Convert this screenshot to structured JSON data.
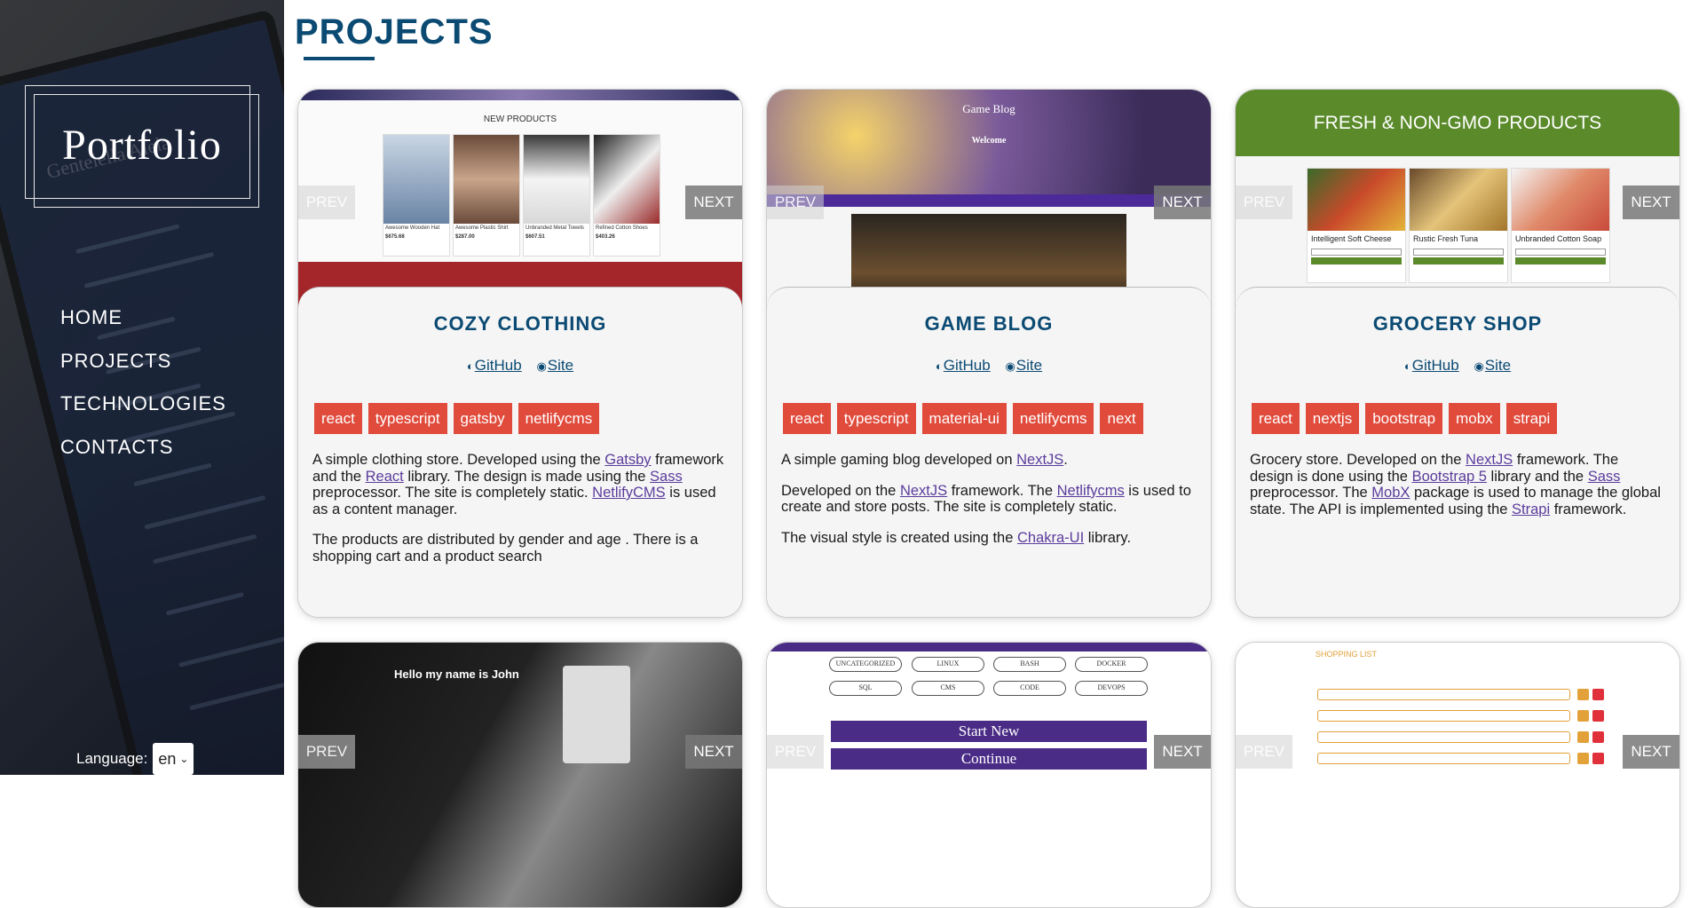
{
  "sidebar": {
    "logo": "Portfolio",
    "nav": [
      "HOME",
      "PROJECTS",
      "TECHNOLOGIES",
      "CONTACTS"
    ],
    "language_label": "Language:",
    "language_value": "en"
  },
  "main": {
    "title": "PROJECTS",
    "carousel": {
      "prev": "PREV",
      "next": "NEXT"
    },
    "links": {
      "github": "GitHub",
      "site": "Site"
    },
    "projects": [
      {
        "title": "COZY CLOTHING",
        "tags": [
          "react",
          "typescript",
          "gatsby",
          "netlifycms"
        ],
        "desc": [
          [
            {
              "t": "A simple clothing store. Developed using the "
            },
            {
              "t": "Gatsby",
              "link": true
            },
            {
              "t": " framework and the "
            },
            {
              "t": "React",
              "link": true
            },
            {
              "t": " library. The design is made using the "
            },
            {
              "t": "Sass",
              "link": true
            },
            {
              "t": " preprocessor. The site is completely static. "
            },
            {
              "t": "NetlifyCMS",
              "link": true
            },
            {
              "t": " is used as a content manager."
            }
          ],
          [
            {
              "t": "The products are distributed by gender and age . There is a shopping cart and a product search"
            }
          ]
        ],
        "screenshot": {
          "heading": "NEW PRODUCTS",
          "products": [
            {
              "name": "Awesome Wooden Hat",
              "price": "$675.68"
            },
            {
              "name": "Awesome Plastic Shirt",
              "price": "$287.00"
            },
            {
              "name": "Unbranded Metal Towels",
              "price": "$607.51"
            },
            {
              "name": "Refined Cotton Shoes",
              "price": "$403.26"
            }
          ]
        }
      },
      {
        "title": "GAME BLOG",
        "tags": [
          "react",
          "typescript",
          "material-ui",
          "netlifycms",
          "next"
        ],
        "desc": [
          [
            {
              "t": "A simple gaming blog developed on "
            },
            {
              "t": "NextJS",
              "link": true
            },
            {
              "t": "."
            }
          ],
          [
            {
              "t": "Developed on the "
            },
            {
              "t": "NextJS",
              "link": true
            },
            {
              "t": " framework. The "
            },
            {
              "t": "Netlifycms",
              "link": true
            },
            {
              "t": " is used to create and store posts. The site is completely static."
            }
          ],
          [
            {
              "t": "The visual style is created using the "
            },
            {
              "t": "Chakra-UI",
              "link": true
            },
            {
              "t": " library."
            }
          ]
        ],
        "screenshot": {
          "brand": "Game Blog",
          "welcome": "Welcome"
        }
      },
      {
        "title": "GROCERY SHOP",
        "tags": [
          "react",
          "nextjs",
          "bootstrap",
          "mobx",
          "strapi"
        ],
        "desc": [
          [
            {
              "t": "Grocery store. Developed on the "
            },
            {
              "t": "NextJS",
              "link": true
            },
            {
              "t": " framework. The design is done using the "
            },
            {
              "t": "Bootstrap 5",
              "link": true
            },
            {
              "t": " library and the "
            },
            {
              "t": "Sass",
              "link": true
            },
            {
              "t": " preprocessor. The "
            },
            {
              "t": "MobX",
              "link": true
            },
            {
              "t": " package is used to manage the global state. The API is implemented using the "
            },
            {
              "t": "Strapi",
              "link": true
            },
            {
              "t": " framework."
            }
          ]
        ],
        "screenshot": {
          "banner": "FRESH & NON-GMO PRODUCTS",
          "products": [
            "Intelligent Soft Cheese",
            "Rustic Fresh Tuna",
            "Unbranded Cotton Soap"
          ]
        }
      }
    ],
    "bottom_screens": {
      "portfolio_heading": "Hello my name is John",
      "quiz_buttons": [
        "UNCATEGORIZED",
        "LINUX",
        "BASH",
        "DOCKER",
        "SQL",
        "CMS",
        "CODE",
        "DEVOPS"
      ],
      "quiz_start": "Start New",
      "quiz_continue": "Continue",
      "shopping_title": "SHOPPING LIST"
    }
  }
}
